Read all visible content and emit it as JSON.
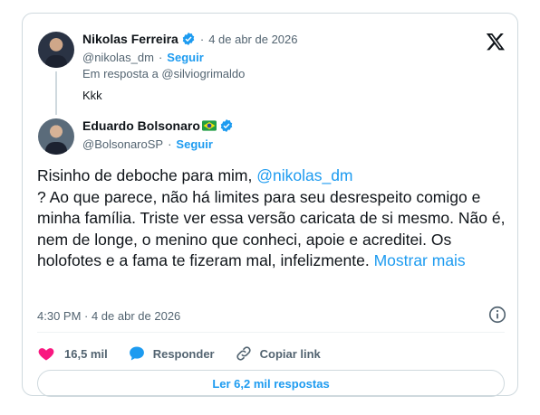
{
  "parent_tweet": {
    "author_name": "Nikolas Ferreira",
    "handle": "@nikolas_dm",
    "date": "4 de abr de 2026",
    "follow_label": "Seguir",
    "reply_context": "Em resposta a @silviogrimaldo",
    "text": "Kkk"
  },
  "main_tweet": {
    "author_name": "Eduardo Bolsonaro",
    "handle": "@BolsonaroSP",
    "follow_label": "Seguir",
    "text_before_mention": "Risinho de deboche para mim, ",
    "mention": "@nikolas_dm",
    "text_after_mention": "? Ao que parece, não há limites para seu desrespeito comigo e minha família. Triste ver essa versão caricata de si mesmo. Não é, nem de longe, o menino que conheci, apoie e acreditei. Os holofotes e a fama te fizeram mal, infelizmente. ",
    "show_more_label": "Mostrar mais",
    "timestamp": "4:30 PM · 4 de abr de 2026"
  },
  "actions": {
    "likes": "16,5 mil",
    "reply_label": "Responder",
    "copy_link_label": "Copiar link"
  },
  "read_replies_label": "Ler 6,2 mil respostas",
  "icons": {
    "brand": "x-logo-icon",
    "verified": "verified-badge-icon",
    "flag": "brazil-flag-icon",
    "info": "info-icon",
    "like": "heart-icon",
    "reply": "speech-bubble-icon",
    "link": "link-icon"
  },
  "colors": {
    "accent": "#1d9bf0",
    "heart": "#f91880",
    "text": "#0f1419",
    "muted": "#536471",
    "border": "#cfd9de"
  }
}
